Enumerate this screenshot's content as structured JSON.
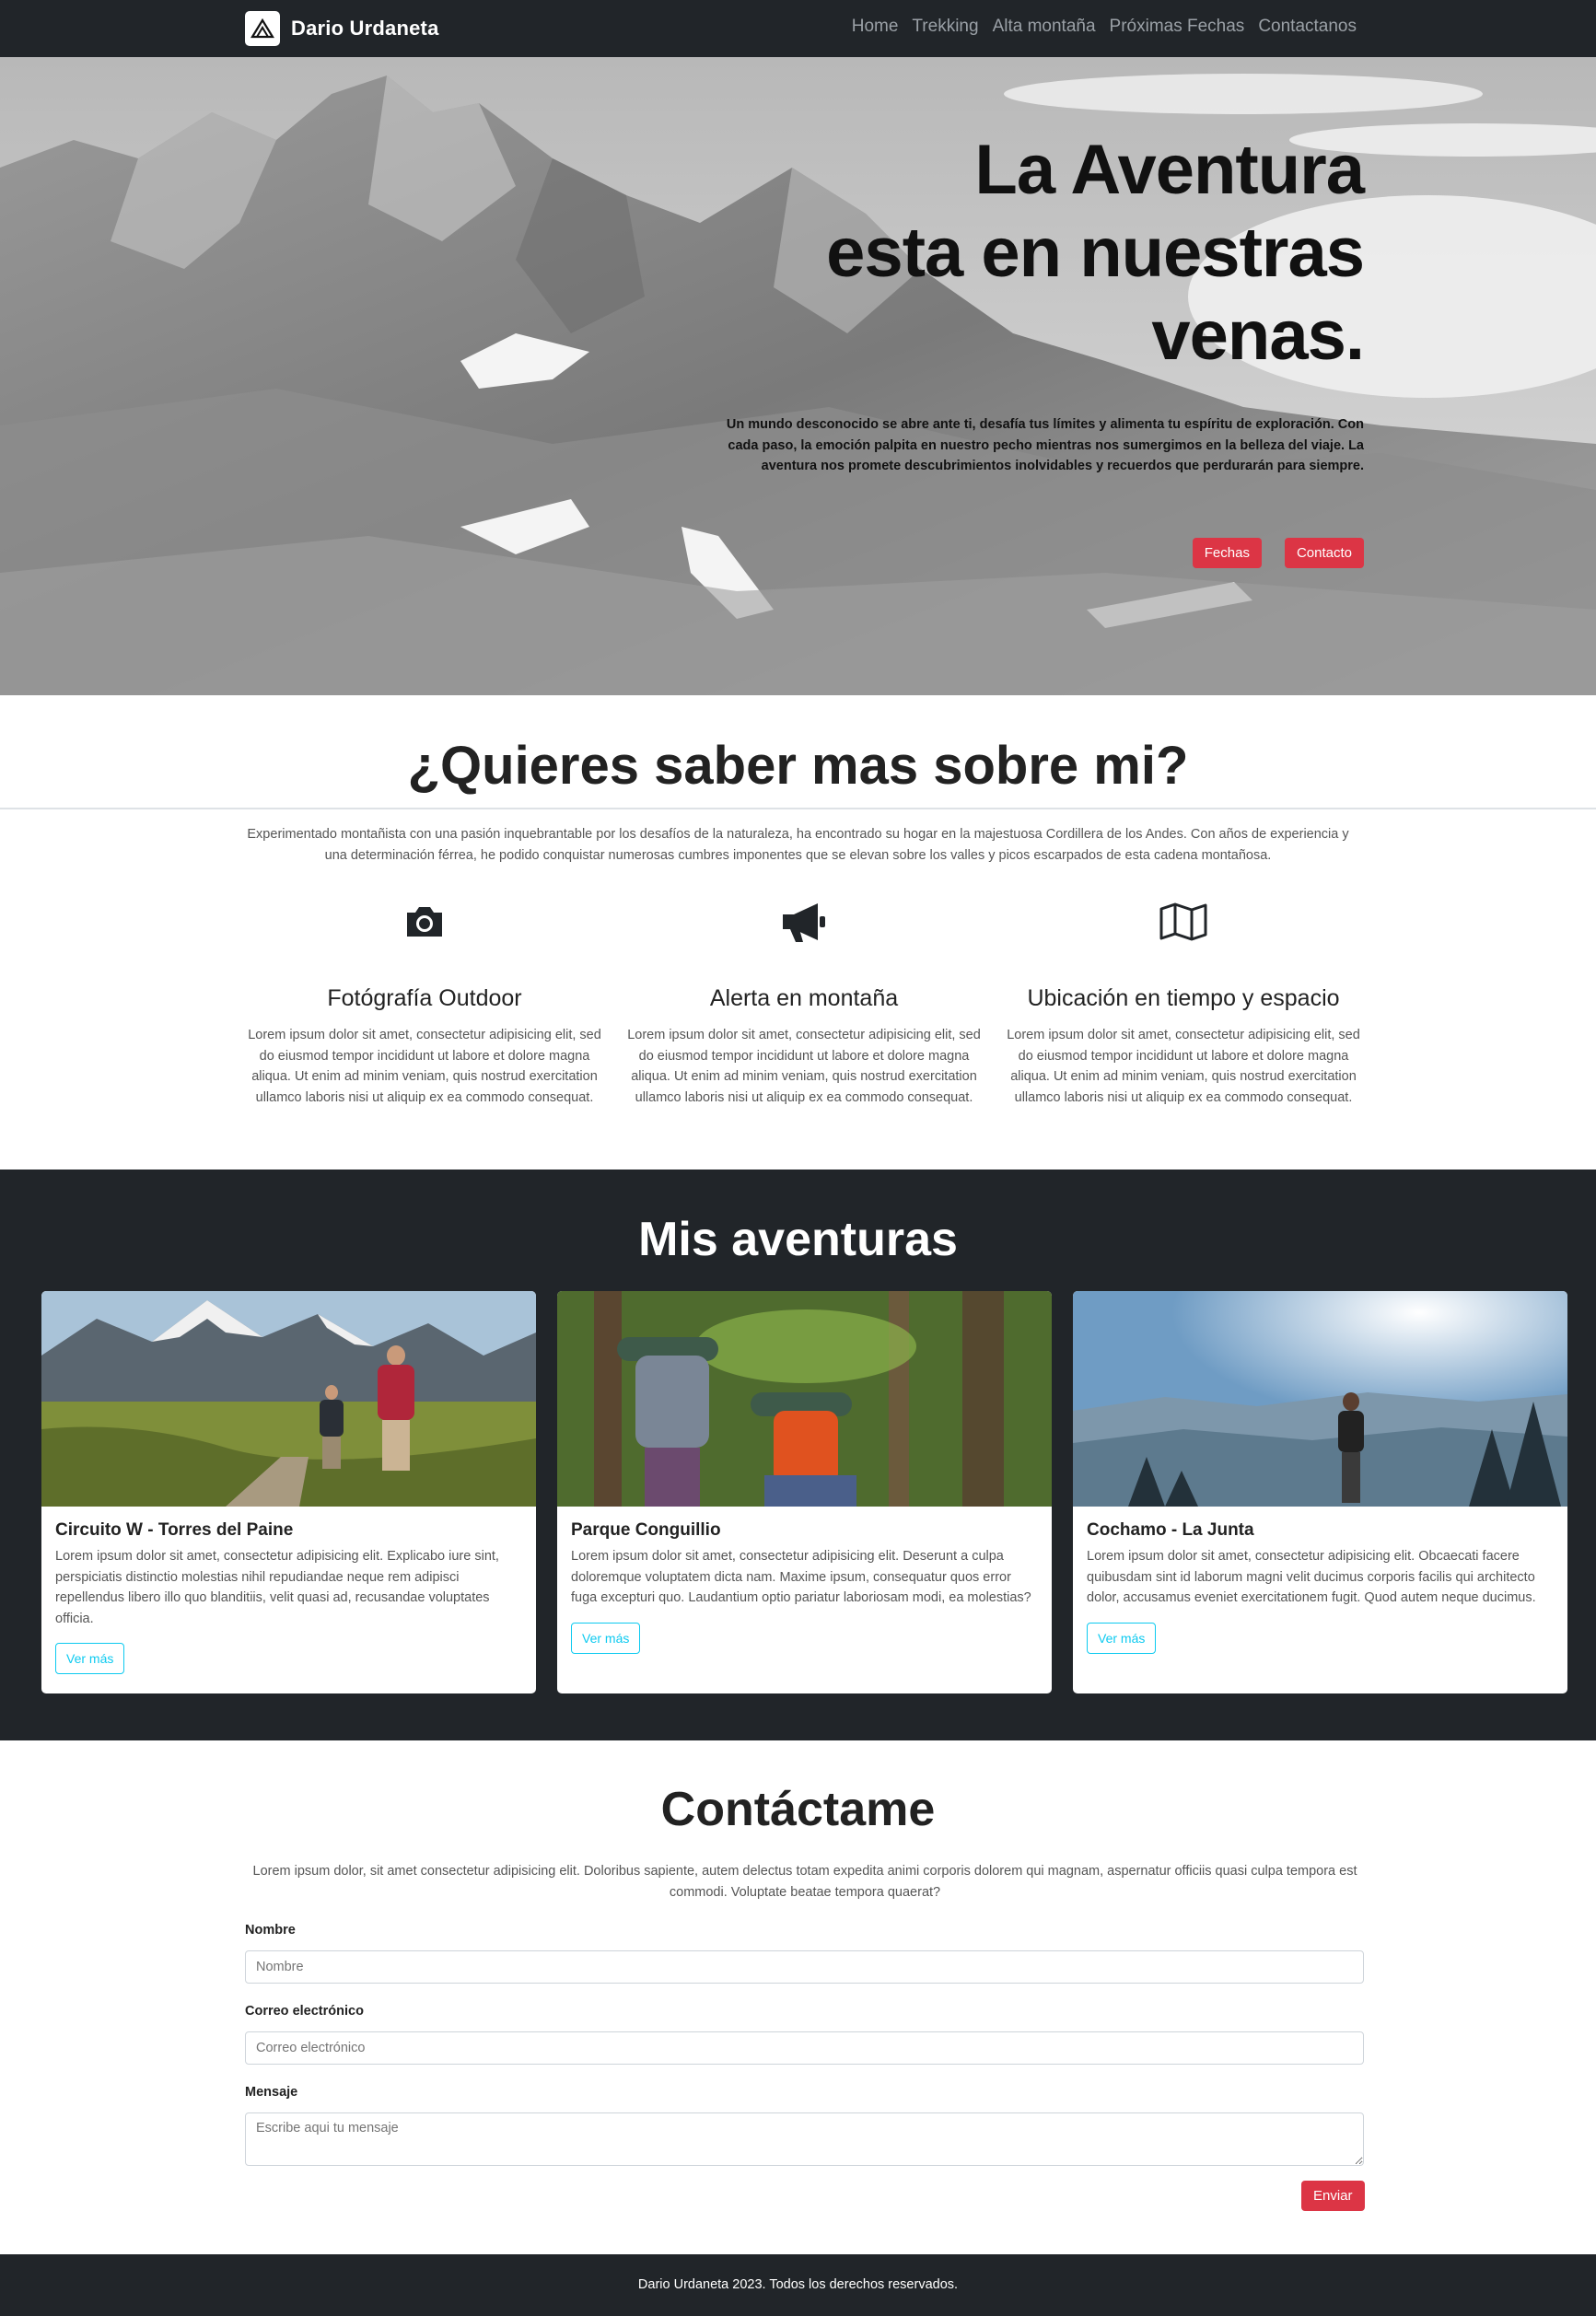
{
  "nav": {
    "brand": "Dario Urdaneta",
    "logo_icon": "mountain-icon",
    "links": [
      "Home",
      "Trekking",
      "Alta montaña",
      "Próximas Fechas",
      "Contactanos"
    ]
  },
  "hero": {
    "title_lines": [
      "La Aventura",
      "esta en nuestras",
      "venas."
    ],
    "text": "Un mundo desconocido se abre ante ti, desafía tus límites y alimenta tu espíritu de exploración. Con cada paso, la emoción palpita en nuestro pecho mientras nos sumergimos en la belleza del viaje. La aventura nos promete descubrimientos inolvidables y recuerdos que perdurarán para siempre.",
    "btn_fechas": "Fechas",
    "btn_contacto": "Contacto",
    "background": "black-and-white mountain landscape"
  },
  "about": {
    "title": "¿Quieres saber mas sobre mi?",
    "text": "Experimentado montañista con una pasión inquebrantable por los desafíos de la naturaleza, ha encontrado su hogar en la majestuosa Cordillera de los Andes. Con años de experiencia y una determinación férrea, he podido conquistar numerosas cumbres imponentes que se elevan sobre los valles y picos escarpados de esta cadena montañosa.",
    "features": [
      {
        "icon": "camera-icon",
        "title": "Fotógrafía Outdoor",
        "text": "Lorem ipsum dolor sit amet, consectetur adipisicing elit, sed do eiusmod tempor incididunt ut labore et dolore magna aliqua. Ut enim ad minim veniam, quis nostrud exercitation ullamco laboris nisi ut aliquip ex ea commodo consequat."
      },
      {
        "icon": "megaphone-icon",
        "title": "Alerta en montaña",
        "text": "Lorem ipsum dolor sit amet, consectetur adipisicing elit, sed do eiusmod tempor incididunt ut labore et dolore magna aliqua. Ut enim ad minim veniam, quis nostrud exercitation ullamco laboris nisi ut aliquip ex ea commodo consequat."
      },
      {
        "icon": "map-icon",
        "title": "Ubicación en tiempo y espacio",
        "text": "Lorem ipsum dolor sit amet, consectetur adipisicing elit, sed do eiusmod tempor incididunt ut labore et dolore magna aliqua. Ut enim ad minim veniam, quis nostrud exercitation ullamco laboris nisi ut aliquip ex ea commodo consequat."
      }
    ]
  },
  "adventures": {
    "title": "Mis aventuras",
    "cards": [
      {
        "title": "Circuito W - Torres del Paine",
        "text": "Lorem ipsum dolor sit amet, consectetur adipisicing elit. Explicabo iure sint, perspiciatis distinctio molestias nihil repudiandae neque rem adipisci repellendus libero illo quo blanditiis, velit quasi ad, recusandae voluptates officia.",
        "button": "Ver más"
      },
      {
        "title": "Parque Conguillio",
        "text": "Lorem ipsum dolor sit amet, consectetur adipisicing elit. Deserunt a culpa doloremque voluptatem dicta nam. Maxime ipsum, consequatur quos error fuga excepturi quo. Laudantium optio pariatur laboriosam modi, ea molestias?",
        "button": "Ver más"
      },
      {
        "title": "Cochamo - La Junta",
        "text": "Lorem ipsum dolor sit amet, consectetur adipisicing elit. Obcaecati facere quibusdam sint id laborum magni velit ducimus corporis facilis qui architecto dolor, accusamus eveniet exercitationem fugit. Quod autem neque ducimus.",
        "button": "Ver más"
      }
    ]
  },
  "contact": {
    "title": "Contáctame",
    "text": "Lorem ipsum dolor, sit amet consectetur adipisicing elit. Doloribus sapiente, autem delectus totam expedita animi corporis dolorem qui magnam, aspernatur officiis quasi culpa tempora est commodi. Voluptate beatae tempora quaerat?",
    "name_label": "Nombre",
    "name_placeholder": "Nombre",
    "email_label": "Correo electrónico",
    "email_placeholder": "Correo electrónico",
    "message_label": "Mensaje",
    "message_placeholder": "Escribe aqui tu mensaje",
    "submit": "Enviar"
  },
  "footer": {
    "text": "Dario Urdaneta 2023. Todos los derechos reservados."
  },
  "colors": {
    "dark": "#212529",
    "accent_red": "#dc3545",
    "accent_cyan": "#0dcaf0"
  }
}
